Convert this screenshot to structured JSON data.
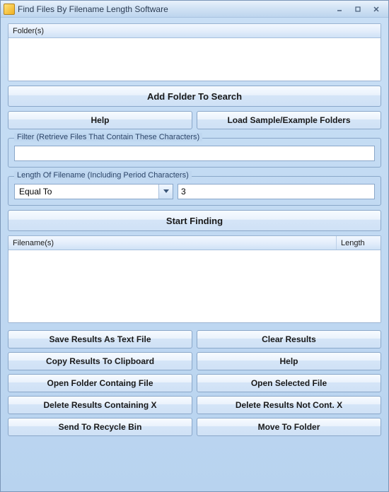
{
  "window": {
    "title": "Find Files By Filename Length Software"
  },
  "folders": {
    "header": "Folder(s)"
  },
  "buttons": {
    "add_folder": "Add Folder To Search",
    "help_top": "Help",
    "load_sample": "Load Sample/Example Folders",
    "start": "Start Finding",
    "save_results": "Save Results As Text File",
    "clear_results": "Clear Results",
    "copy_results": "Copy Results To Clipboard",
    "help_bottom": "Help",
    "open_folder": "Open Folder Containg File",
    "open_selected": "Open Selected File",
    "delete_containing": "Delete Results Containing X",
    "delete_not_cont": "Delete Results Not Cont. X",
    "recycle": "Send To Recycle Bin",
    "move": "Move To Folder"
  },
  "filter": {
    "legend": "Filter (Retrieve Files That Contain These Characters)",
    "value": ""
  },
  "length": {
    "legend": "Length Of Filename (Including Period Characters)",
    "operator": "Equal To",
    "value": "3"
  },
  "results": {
    "col_filename": "Filename(s)",
    "col_length": "Length"
  }
}
